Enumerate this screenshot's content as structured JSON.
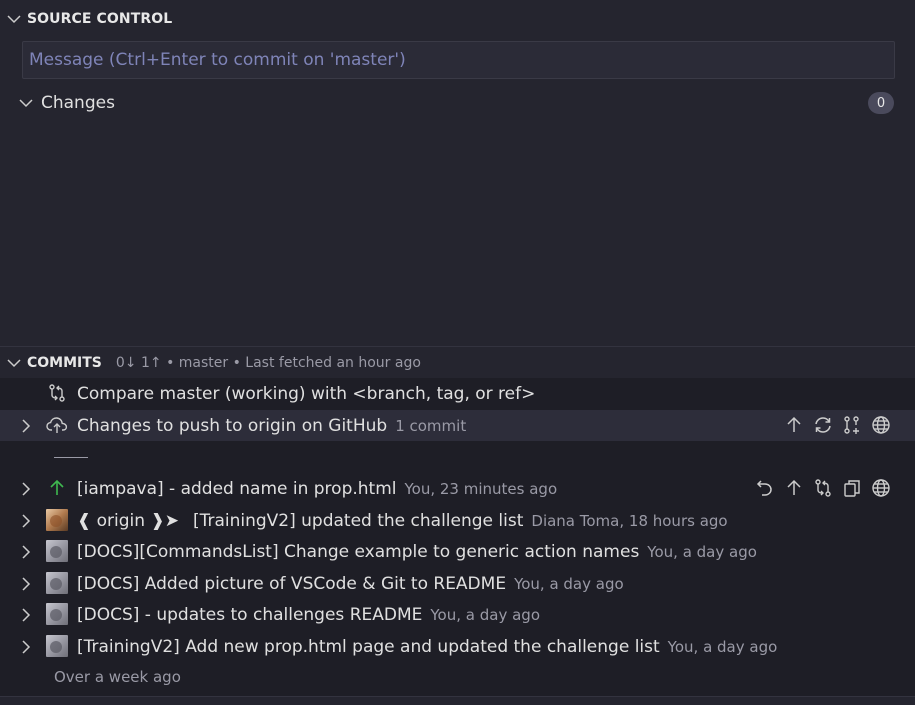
{
  "source_control": {
    "title": "SOURCE CONTROL",
    "message_placeholder": "Message (Ctrl+Enter to commit on 'master')",
    "changes_label": "Changes",
    "changes_count": "0"
  },
  "commits": {
    "title": "COMMITS",
    "description": "0↓ 1↑ • master • Last fetched an hour ago",
    "compare_label": "Compare master (working) with <branch, tag, or ref>",
    "push_label": "Changes to push to origin on GitHub",
    "push_count": "1 commit",
    "items": [
      {
        "message": "[iampava] - added name in prop.html",
        "meta": "You, 23 minutes ago"
      },
      {
        "tag": "❰ origin ❱➤",
        "message": "[TrainingV2] updated the challenge list",
        "meta": "Diana Toma, 18 hours ago"
      },
      {
        "message": "[DOCS][CommandsList] Change example to generic action names",
        "meta": "You, a day ago"
      },
      {
        "message": "[DOCS] Added picture of VSCode & Git to README",
        "meta": "You, a day ago"
      },
      {
        "message": "[DOCS] - updates to challenges README",
        "meta": "You, a day ago"
      },
      {
        "message": "[TrainingV2] Add new prop.html page and updated the challenge list",
        "meta": "You, a day ago"
      }
    ],
    "footer": "Over a week ago"
  },
  "colors": {
    "background": "#25252f",
    "commits_background": "#1e1e26",
    "placeholder": "#7f84b8",
    "arrow_green": "#3fb950"
  },
  "icons": [
    "chevron-down-icon",
    "chevron-right-icon",
    "compare-icon",
    "cloud-upload-icon",
    "arrow-up-icon",
    "sync-icon",
    "pull-request-icon",
    "globe-icon",
    "undo-icon",
    "copy-icon",
    "avatar"
  ]
}
